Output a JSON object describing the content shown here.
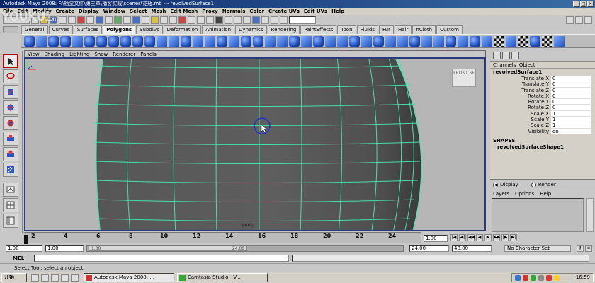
{
  "window": {
    "title": "Autodesk Maya 2008: F:\\杨显文件\\第三章\\播客实践\\scenes\\花瓶.mb  ---  revolvedSurface1"
  },
  "watermark": {
    "text": "YOUKU",
    "suffix": ".com"
  },
  "menubar": [
    "File",
    "Edit",
    "Modify",
    "Create",
    "Display",
    "Window",
    "Select",
    "Mesh",
    "Edit Mesh",
    "Proxy",
    "Normals",
    "Color",
    "Create UVs",
    "Edit UVs",
    "Help"
  ],
  "shelf_tabs": [
    "General",
    "Curves",
    "Surfaces",
    "Polygons",
    "Subdivs",
    "Deformation",
    "Animation",
    "Dynamics",
    "Rendering",
    "PaintEffects",
    "Toon",
    "Fluids",
    "Fur",
    "Hair",
    "nCloth",
    "Custom"
  ],
  "active_shelf_tab": "Polygons",
  "viewport": {
    "menu": [
      "View",
      "Shading",
      "Lighting",
      "Show",
      "Renderer",
      "Panels"
    ],
    "viewcube_label": "FRONT",
    "viewcube_side": "SF",
    "camera_label": "persp"
  },
  "channel_box": {
    "header": [
      "Channels",
      "Object"
    ],
    "node": "revolvedSurface1",
    "attributes": [
      {
        "label": "Translate X",
        "value": "0"
      },
      {
        "label": "Translate Y",
        "value": "0"
      },
      {
        "label": "Translate Z",
        "value": "0"
      },
      {
        "label": "Rotate X",
        "value": "0"
      },
      {
        "label": "Rotate Y",
        "value": "0"
      },
      {
        "label": "Rotate Z",
        "value": "0"
      },
      {
        "label": "Scale X",
        "value": "1"
      },
      {
        "label": "Scale Y",
        "value": "1"
      },
      {
        "label": "Scale Z",
        "value": "1"
      },
      {
        "label": "Visibility",
        "value": "on"
      }
    ],
    "shapes_heading": "SHAPES",
    "shape_node": "revolvedSurfaceShape1"
  },
  "layer_editor": {
    "display_label": "Display",
    "render_label": "Render",
    "mode": "Display",
    "menu": [
      "Layers",
      "Options",
      "Help"
    ]
  },
  "time_slider": {
    "ticks": [
      "2",
      "4",
      "6",
      "8",
      "10",
      "12",
      "14",
      "16",
      "18",
      "20",
      "22",
      "24"
    ],
    "current_frame": "1.00"
  },
  "range_slider": {
    "start_time": "1.00",
    "playback_start": "1.00",
    "range_left": "1.00",
    "range_right": "24.00",
    "playback_end": "24.00",
    "end_time": "48.00",
    "character_set": "No Character Set"
  },
  "command_line": {
    "label": "MEL"
  },
  "help_line": "Select Tool: select an object",
  "taskbar": {
    "start_label": "开始",
    "items": [
      {
        "label": "Autodesk Maya 2008: ...",
        "active": true
      },
      {
        "label": "Camtasia Studio - V...",
        "active": false
      }
    ],
    "clock": "16:59"
  },
  "colors": {
    "viewport_bg": "#b6b6b6",
    "mesh_fill": "#5a5a5a",
    "wire": "#49e3b0",
    "selection_frame": "#2a3a7a",
    "active_tool": "#b00000"
  },
  "icons": {
    "toolbox": [
      "select-tool-icon",
      "lasso-tool-icon",
      "paint-select-icon",
      "move-tool-icon",
      "rotate-tool-icon",
      "scale-tool-icon",
      "soft-mod-icon",
      "show-manipulator-icon",
      "last-tool-icon",
      "single-perspective-layout-icon",
      "four-view-layout-icon",
      "perspective-outliner-layout-icon",
      "outliner-layout-icon"
    ]
  }
}
